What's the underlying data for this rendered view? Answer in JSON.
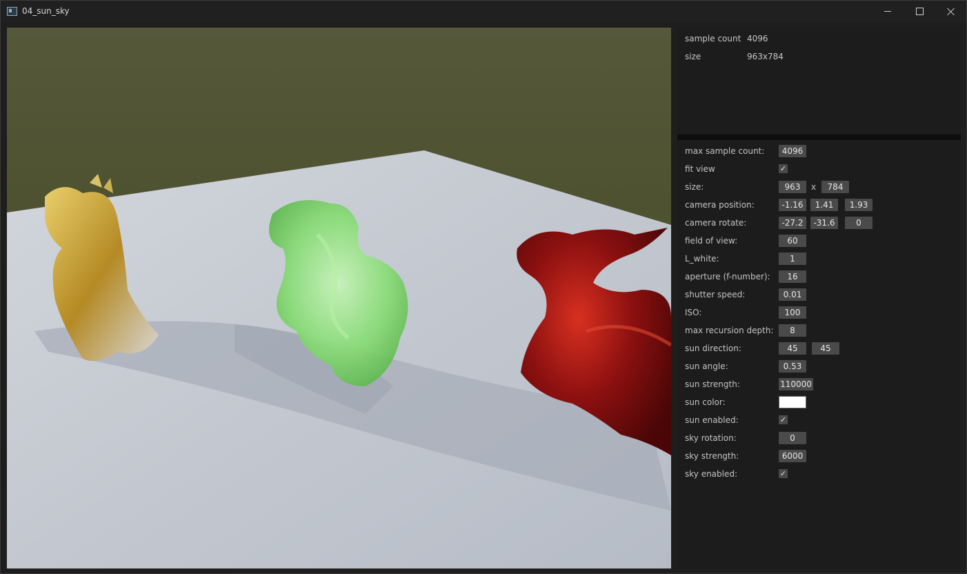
{
  "window": {
    "title": "04_sun_sky"
  },
  "info": {
    "sample_count_label": "sample count",
    "sample_count_value": "4096",
    "size_label": "size",
    "size_value": "963x784"
  },
  "settings": {
    "max_sample_count": {
      "label": "max sample count:",
      "value": "4096"
    },
    "fit_view": {
      "label": "fit view",
      "checked": "✓"
    },
    "size": {
      "label": "size:",
      "width": "963",
      "sep": "x",
      "height": "784"
    },
    "camera_position": {
      "label": "camera position:",
      "x": "-1.16",
      "y": "1.41",
      "z": "1.93"
    },
    "camera_rotate": {
      "label": "camera rotate:",
      "x": "-27.2",
      "y": "-31.6",
      "z": "0"
    },
    "field_of_view": {
      "label": "field of view:",
      "value": "60"
    },
    "l_white": {
      "label": "L_white:",
      "value": "1"
    },
    "aperture": {
      "label": "aperture (f-number):",
      "value": "16"
    },
    "shutter_speed": {
      "label": "shutter speed:",
      "value": "0.01"
    },
    "iso": {
      "label": "ISO:",
      "value": "100"
    },
    "max_recursion_depth": {
      "label": "max recursion depth:",
      "value": "8"
    },
    "sun_direction": {
      "label": "sun direction:",
      "a": "45",
      "b": "45"
    },
    "sun_angle": {
      "label": "sun angle:",
      "value": "0.53"
    },
    "sun_strength": {
      "label": "sun strength:",
      "value": "110000"
    },
    "sun_color": {
      "label": "sun color:",
      "color": "#ffffff"
    },
    "sun_enabled": {
      "label": "sun enabled:",
      "checked": "✓"
    },
    "sky_rotation": {
      "label": "sky rotation:",
      "value": "0"
    },
    "sky_strength": {
      "label": "sky strength:",
      "value": "6000"
    },
    "sky_enabled": {
      "label": "sky enabled:",
      "checked": "✓"
    }
  },
  "render": {
    "grass_color": "#4c5231",
    "floor_color": "#c4c8d0",
    "gold_dragon_color": "#c9a23a",
    "glass_dragon_color": "#7ed86e",
    "red_dragon_color": "#9a1212"
  }
}
